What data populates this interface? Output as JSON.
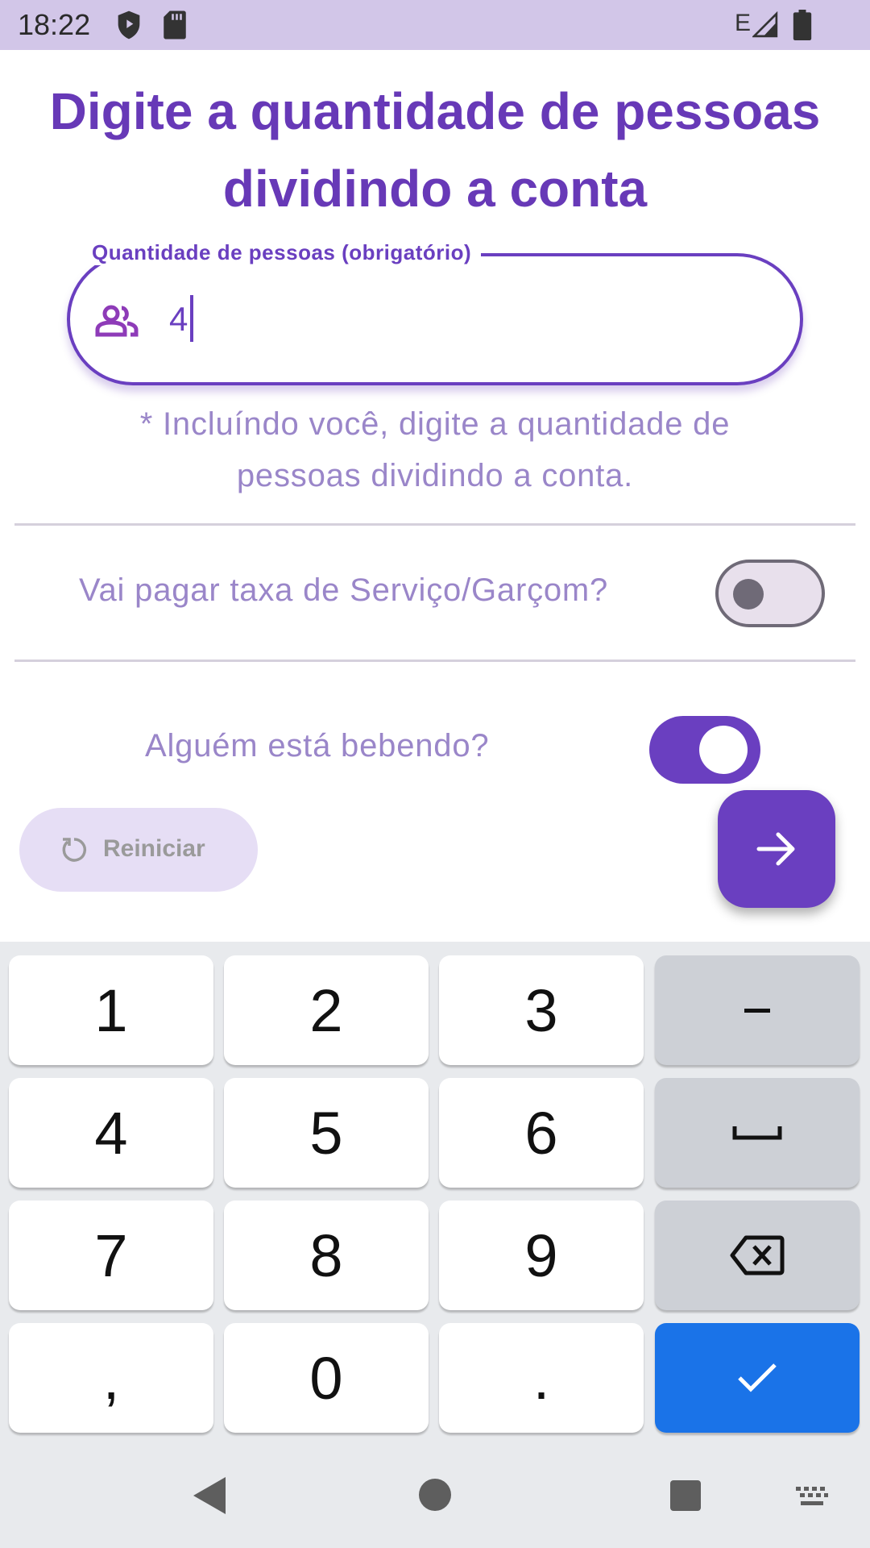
{
  "status_bar": {
    "time": "18:22",
    "network": "E"
  },
  "title": "Digite a quantidade de pessoas dividindo a conta",
  "people_field": {
    "label": "Quantidade de pessoas (obrigatório)",
    "value": "4",
    "helper": "* Incluíndo você, digite a quantidade de pessoas dividindo a conta."
  },
  "service_fee": {
    "label": "Vai pagar taxa de Serviço/Garçom?",
    "on": false
  },
  "drinking": {
    "label": "Alguém está bebendo?",
    "on": true
  },
  "reset_button": {
    "label": "Reiniciar"
  },
  "keyboard": {
    "keys": [
      "1",
      "2",
      "3",
      "-",
      "4",
      "5",
      "6",
      "␣",
      "7",
      "8",
      "9",
      "⌫",
      ",",
      "0",
      ".",
      "✓"
    ]
  },
  "colors": {
    "accent": "#6a3fc0",
    "status_bar": "#d2c6e8",
    "enter_key": "#1a73e8"
  }
}
